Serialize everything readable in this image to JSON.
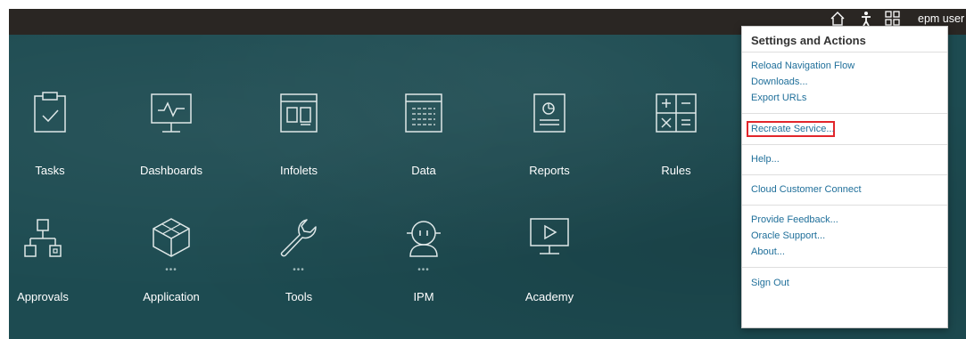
{
  "header": {
    "user_label": "epm user",
    "icons": [
      "home-icon",
      "accessibility-icon",
      "navigator-grid-icon"
    ]
  },
  "tiles_row1": [
    {
      "label": "Tasks",
      "icon": "tasks-clipboard-icon"
    },
    {
      "label": "Dashboards",
      "icon": "dashboards-monitor-icon"
    },
    {
      "label": "Infolets",
      "icon": "infolets-icon"
    },
    {
      "label": "Data",
      "icon": "data-form-icon"
    },
    {
      "label": "Reports",
      "icon": "reports-icon"
    },
    {
      "label": "Rules",
      "icon": "rules-calculator-icon"
    }
  ],
  "tiles_row2": [
    {
      "label": "Approvals",
      "icon": "approvals-hierarchy-icon"
    },
    {
      "label": "Application",
      "icon": "application-cube-icon",
      "more": "•••"
    },
    {
      "label": "Tools",
      "icon": "tools-wrench-icon",
      "more": "•••"
    },
    {
      "label": "IPM",
      "icon": "ipm-robot-icon",
      "more": "•••"
    },
    {
      "label": "Academy",
      "icon": "academy-video-icon"
    }
  ],
  "menu": {
    "title": "Settings and Actions",
    "items": [
      "Reload Navigation Flow",
      "Downloads...",
      "Export URLs",
      "Recreate Service...",
      "Help...",
      "Cloud Customer Connect",
      "Provide Feedback...",
      "Oracle Support...",
      "About...",
      "Sign Out"
    ],
    "highlighted_item": "Recreate Service...",
    "highlight_color": "#e2262b"
  },
  "colors": {
    "topbar": "#2a2623",
    "background": "#1d4b51",
    "menu_link": "#1f6f9a"
  }
}
